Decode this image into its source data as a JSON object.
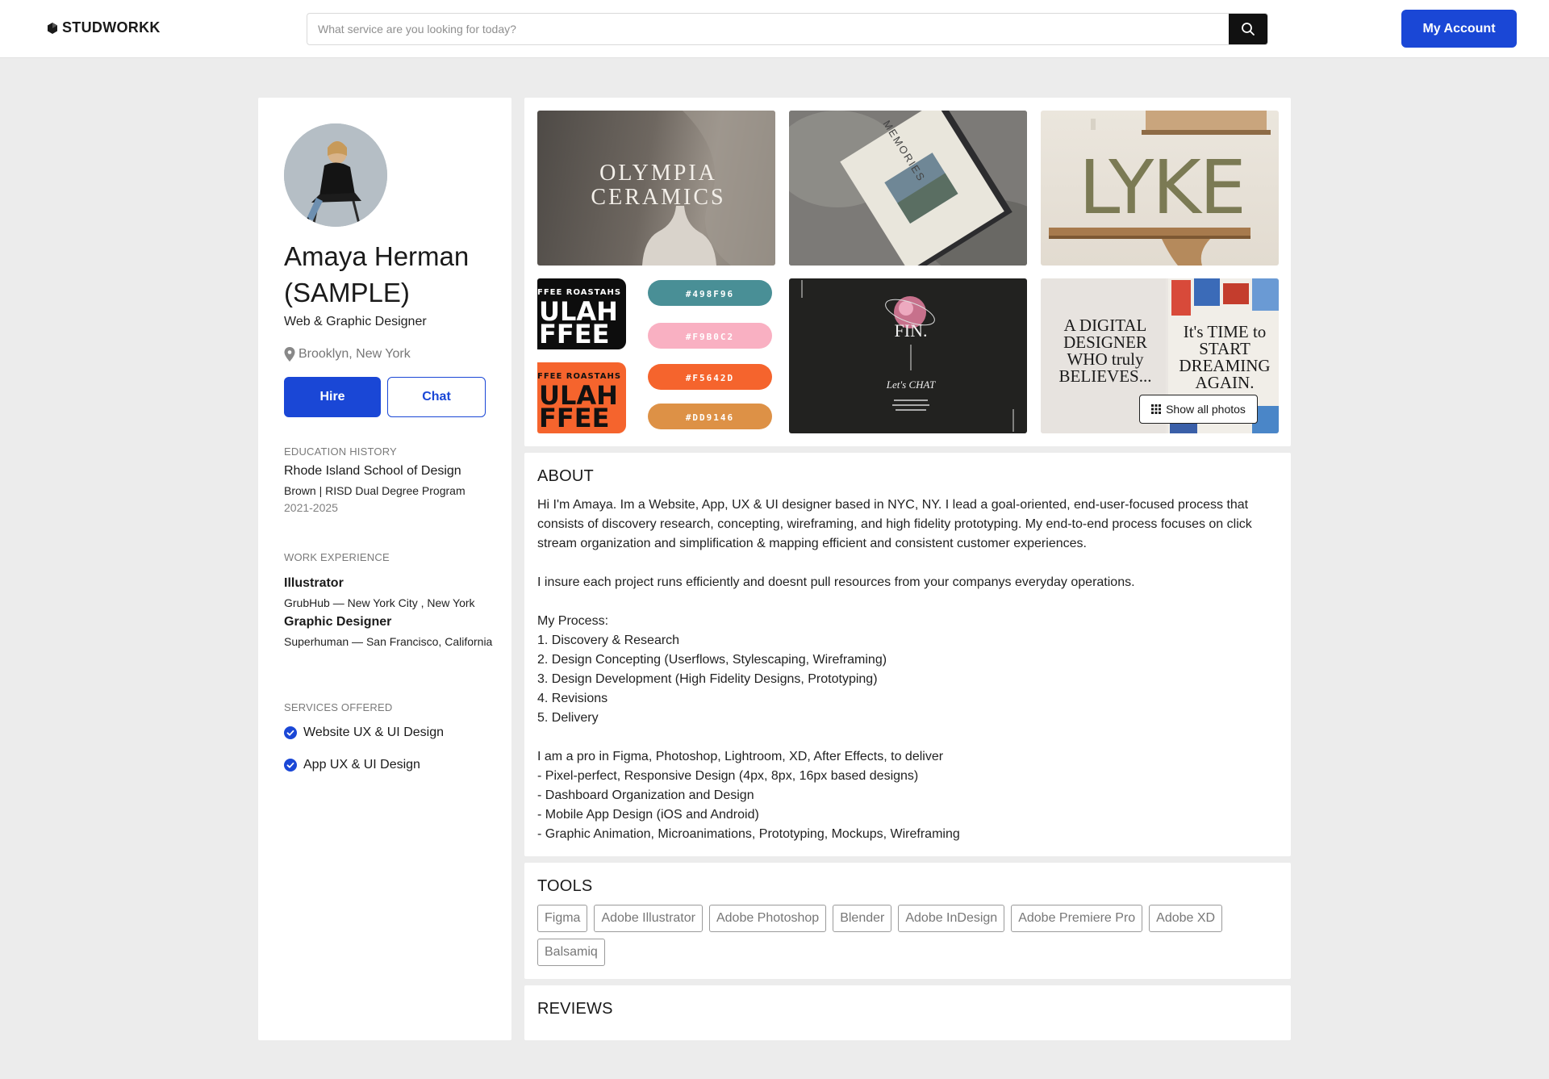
{
  "header": {
    "logo_text": "STUDWORKK",
    "search_placeholder": "What service are you looking for today?",
    "account_label": "My Account"
  },
  "colors": {
    "accent": "#1a47d6",
    "page_bg": "#ececec",
    "swatches": [
      "#498F96",
      "#F9B0C2",
      "#F5642D",
      "#DD9146"
    ]
  },
  "profile": {
    "name": "Amaya Herman (SAMPLE)",
    "role": "Web & Graphic Designer",
    "location": "Brooklyn, New York",
    "hire_label": "Hire",
    "chat_label": "Chat"
  },
  "education": {
    "label": "EDUCATION HISTORY",
    "school": "Rhode Island School of Design",
    "program": "Brown | RISD Dual Degree Program",
    "years": "2021-2025"
  },
  "work": {
    "label": "WORK EXPERIENCE",
    "jobs": [
      {
        "title": "Illustrator",
        "company": "GrubHub — New York City , New York"
      },
      {
        "title": "Graphic Designer",
        "company": "Superhuman — San Francisco, California"
      }
    ]
  },
  "services": {
    "label": "SERVICES OFFERED",
    "items": [
      "Website UX & UI Design",
      "App UX & UI Design"
    ]
  },
  "gallery": {
    "photo1": {
      "line1": "OLYMPIA",
      "line2": "CERAMICS"
    },
    "photo2": {
      "text": "MEMORIES"
    },
    "photo3": {
      "text": "LYKE"
    },
    "photo4": {
      "banner": "FFEE ROASTAHS",
      "word1": "ULAH",
      "word2": "FFEE",
      "swatch_labels": [
        "#498F96",
        "#F9B0C2",
        "#F5642D",
        "#DD9146"
      ]
    },
    "photo5": {
      "title": "FIN.",
      "subtitle": "Let's CHAT"
    },
    "photo6": {
      "left_text": "A DIGITAL DESIGNER WHO truly BELIEVES...",
      "right_text": "It's TIME to START DREAMING AGAIN."
    },
    "show_all_label": "Show all photos"
  },
  "about": {
    "title": "ABOUT",
    "body": "Hi I'm Amaya. Im a Website, App, UX & UI designer based in NYC, NY. I lead a goal-oriented, end-user-focused process that consists of discovery research, concepting, wireframing, and high fidelity prototyping. My end-to-end process focuses on click stream organization and simplification & mapping efficient and consistent customer experiences.\n\nI insure each project runs efficiently and doesnt pull resources from your companys everyday operations.\n\nMy Process:\n1. Discovery & Research\n2. Design Concepting (Userflows, Stylescaping, Wireframing)\n3. Design Development (High Fidelity Designs, Prototyping)\n4. Revisions\n5. Delivery\n\nI am a pro in Figma, Photoshop, Lightroom, XD, After Effects, to deliver\n- Pixel-perfect, Responsive Design (4px, 8px, 16px based designs)\n- Dashboard Organization and Design\n- Mobile App Design (iOS and Android)\n- Graphic Animation, Microanimations, Prototyping, Mockups, Wireframing"
  },
  "tools": {
    "title": "TOOLS",
    "items": [
      "Figma",
      "Adobe Illustrator",
      "Adobe Photoshop",
      "Blender",
      "Adobe InDesign",
      "Adobe Premiere Pro",
      "Adobe XD",
      "Balsamiq"
    ]
  },
  "reviews": {
    "title": "REVIEWS"
  }
}
